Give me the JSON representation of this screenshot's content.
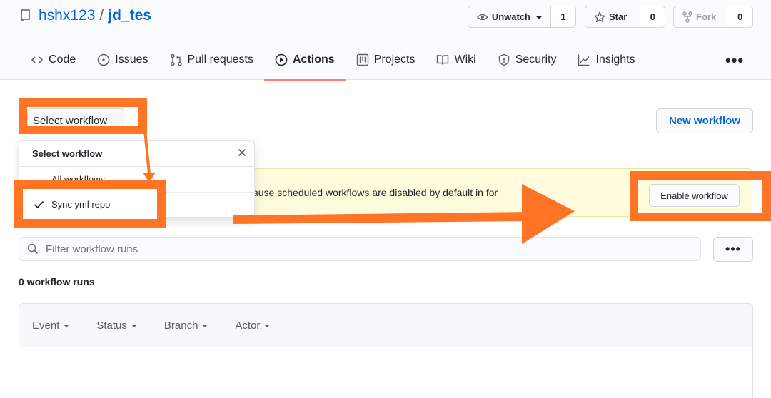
{
  "repo": {
    "owner": "hshx123",
    "separator": "/",
    "name": "jd_tes"
  },
  "header_buttons": {
    "watch": {
      "label": "Unwatch",
      "count": "1"
    },
    "star": {
      "label": "Star",
      "count": "0"
    },
    "fork": {
      "label": "Fork",
      "count": "0"
    }
  },
  "tabs": [
    {
      "label": "Code",
      "icon": "code-icon"
    },
    {
      "label": "Issues",
      "icon": "issue-icon"
    },
    {
      "label": "Pull requests",
      "icon": "pull-request-icon"
    },
    {
      "label": "Actions",
      "icon": "play-icon",
      "active": true
    },
    {
      "label": "Projects",
      "icon": "project-icon"
    },
    {
      "label": "Wiki",
      "icon": "book-icon"
    },
    {
      "label": "Security",
      "icon": "shield-icon"
    },
    {
      "label": "Insights",
      "icon": "graph-icon"
    }
  ],
  "actions": {
    "select_workflow": "Select workflow",
    "new_workflow": "New workflow",
    "banner_text": "ause scheduled workflows are disabled by default in for",
    "enable_workflow": "Enable workflow",
    "dropdown": {
      "title": "Select workflow",
      "items": [
        "All workflows",
        "Sync yml repo"
      ],
      "selected": "Sync yml repo"
    },
    "filter_placeholder": "Filter workflow runs",
    "runs_count": "0 workflow runs",
    "filters": [
      "Event",
      "Status",
      "Branch",
      "Actor"
    ]
  },
  "colors": {
    "annotation": "#ff7425",
    "link": "#0366d6",
    "active_tab_underline": "#f9826c",
    "banner_bg": "#fffbdd"
  }
}
